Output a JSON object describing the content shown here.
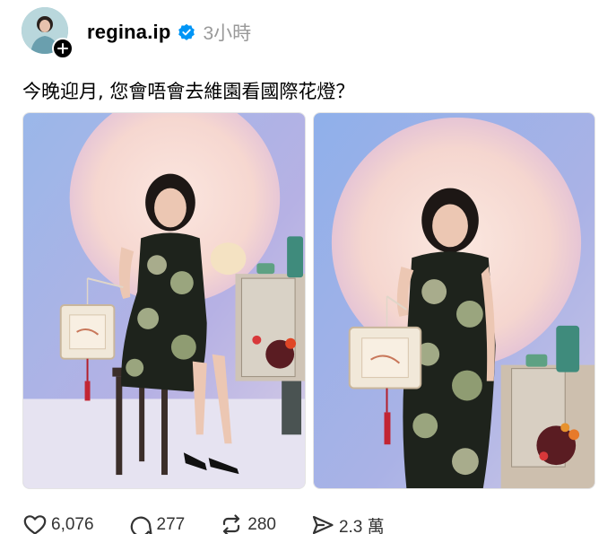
{
  "post": {
    "username": "regina.ip",
    "timestamp": "3小時",
    "caption": "今晚迎月, 您會唔會去維園看國際花燈？"
  },
  "actions": {
    "likes": "6,076",
    "replies": "277",
    "reposts": "280",
    "shares": "2.3 萬"
  },
  "icons": {
    "avatar_badge": "plus-icon",
    "verified": "verified-badge-icon",
    "like": "heart-icon",
    "reply": "comment-bubble-icon",
    "repost": "repost-icon",
    "share": "send-icon"
  },
  "colors": {
    "verified_blue": "#0095f6",
    "text_primary": "#000000",
    "text_secondary": "#999999"
  }
}
